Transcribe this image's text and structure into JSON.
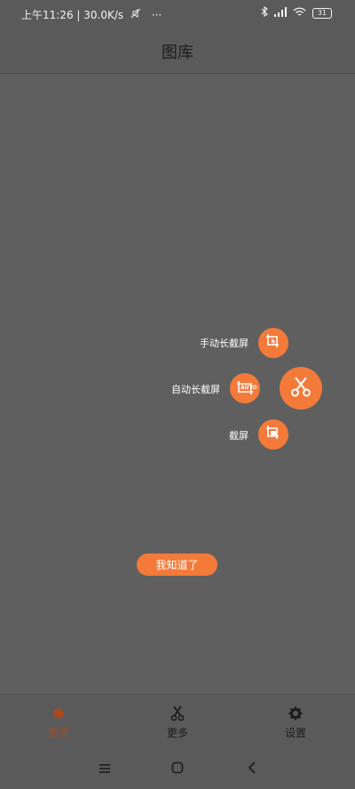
{
  "status_bar": {
    "time_speed": "上午11:26 | 30.0K/s",
    "more_dots": "···",
    "battery": "31"
  },
  "header": {
    "title": "图库"
  },
  "fab_menu": {
    "items": [
      {
        "label": "手动长截屏",
        "icon": "manual-long-screenshot-icon"
      },
      {
        "label": "自动长截屏",
        "icon": "auto-long-screenshot-icon",
        "badge": "AUTO"
      },
      {
        "label": "截屏",
        "icon": "screenshot-icon"
      }
    ],
    "main_icon": "scissors-icon"
  },
  "got_it_button": {
    "label": "我知道了"
  },
  "bottom_nav": {
    "tabs": [
      {
        "label": "图库",
        "icon": "gallery-icon",
        "active": true
      },
      {
        "label": "更多",
        "icon": "scissors-icon",
        "active": false
      },
      {
        "label": "设置",
        "icon": "gear-icon",
        "active": false
      }
    ]
  },
  "colors": {
    "accent": "#f47a3a",
    "overlay": "#5f5f5f",
    "active_tab": "#a84a1f"
  }
}
